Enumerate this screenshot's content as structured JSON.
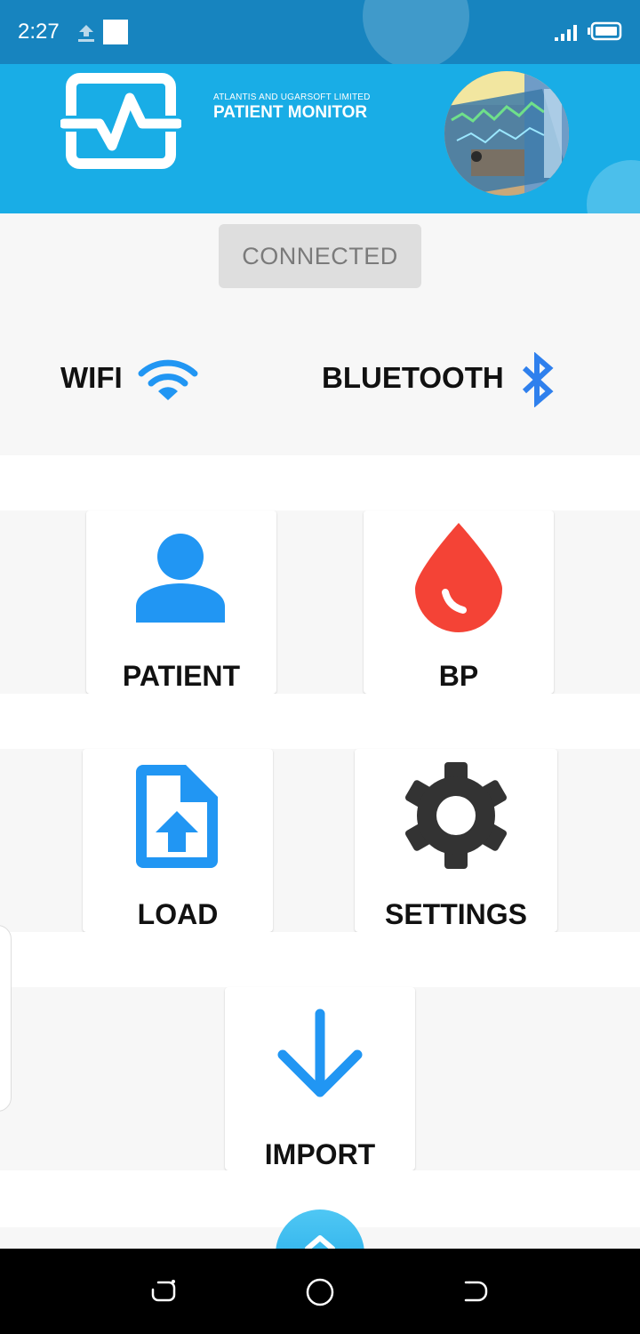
{
  "status_bar": {
    "time": "2:27"
  },
  "header": {
    "company": "ATLANTIS AND UGARSOFT LIMITED",
    "title": "PATIENT MONITOR"
  },
  "connection": {
    "button_label": "CONNECTED",
    "wifi_label": "WIFI",
    "bluetooth_label": "BLUETOOTH"
  },
  "menu": {
    "patient": "PATIENT",
    "bp": "BP",
    "load": "LOAD",
    "settings": "SETTINGS",
    "import": "IMPORT"
  },
  "icons": {
    "patient": "person-icon",
    "bp": "blood-drop-icon",
    "load": "file-upload-icon",
    "settings": "gear-icon",
    "import": "arrow-down-icon",
    "wifi": "wifi-icon",
    "bluetooth": "bluetooth-icon"
  },
  "colors": {
    "header": "#19ade6",
    "status_bar": "#1784bf",
    "accent_blue": "#2196f3",
    "bp_red": "#f44336",
    "gear": "#333333"
  }
}
